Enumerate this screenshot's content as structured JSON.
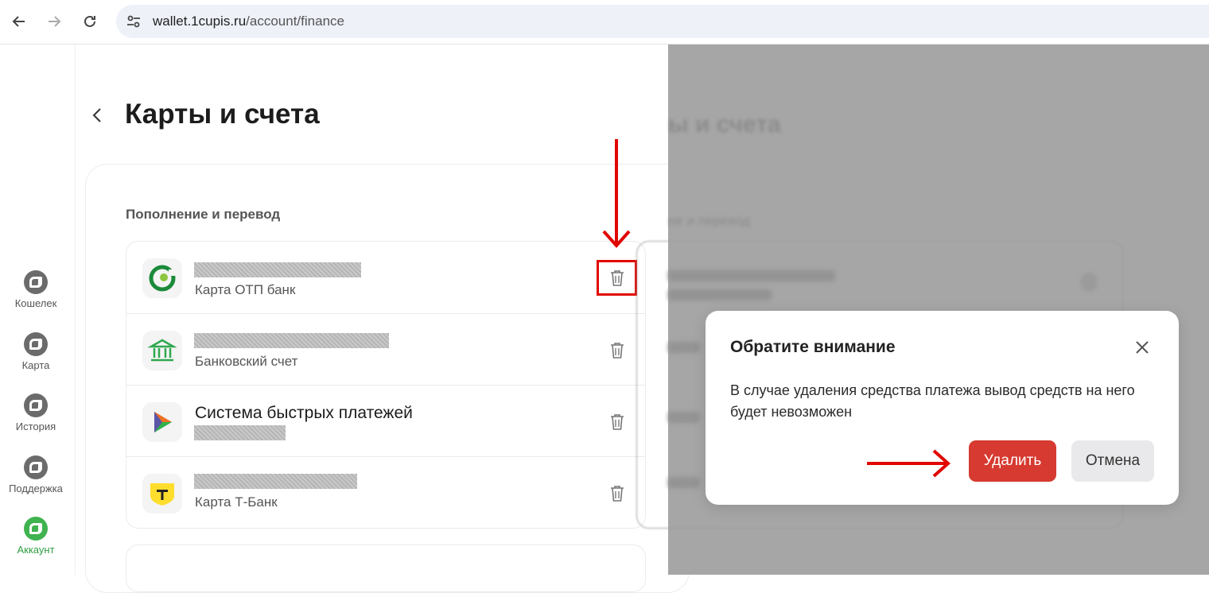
{
  "browser": {
    "url_host": "wallet.1cupis.ru",
    "url_path": "/account/finance"
  },
  "rail": {
    "items": [
      {
        "label": "Кошелек"
      },
      {
        "label": "Карта"
      },
      {
        "label": "История"
      },
      {
        "label": "Поддержка"
      },
      {
        "label": "Аккаунт"
      }
    ]
  },
  "page": {
    "title": "Карты и счета",
    "section_label": "Пополнение и перевод"
  },
  "methods": [
    {
      "title": "",
      "subtitle": "Карта ОТП банк"
    },
    {
      "title": "",
      "subtitle": "Банковский счет"
    },
    {
      "title": "Система быстрых платежей",
      "subtitle": ""
    },
    {
      "title": "",
      "subtitle": "Карта Т-Банк"
    }
  ],
  "background_blurred": {
    "title": "ы и счета",
    "section_label": "не и перевод"
  },
  "modal": {
    "title": "Обратите внимание",
    "text": "В случае удаления средства платежа вывод средств на него будет невозможен",
    "delete_label": "Удалить",
    "cancel_label": "Отмена"
  },
  "colors": {
    "accent_red": "#d63a30",
    "annotation_red": "#e10600",
    "active_green": "#3fb34f"
  }
}
